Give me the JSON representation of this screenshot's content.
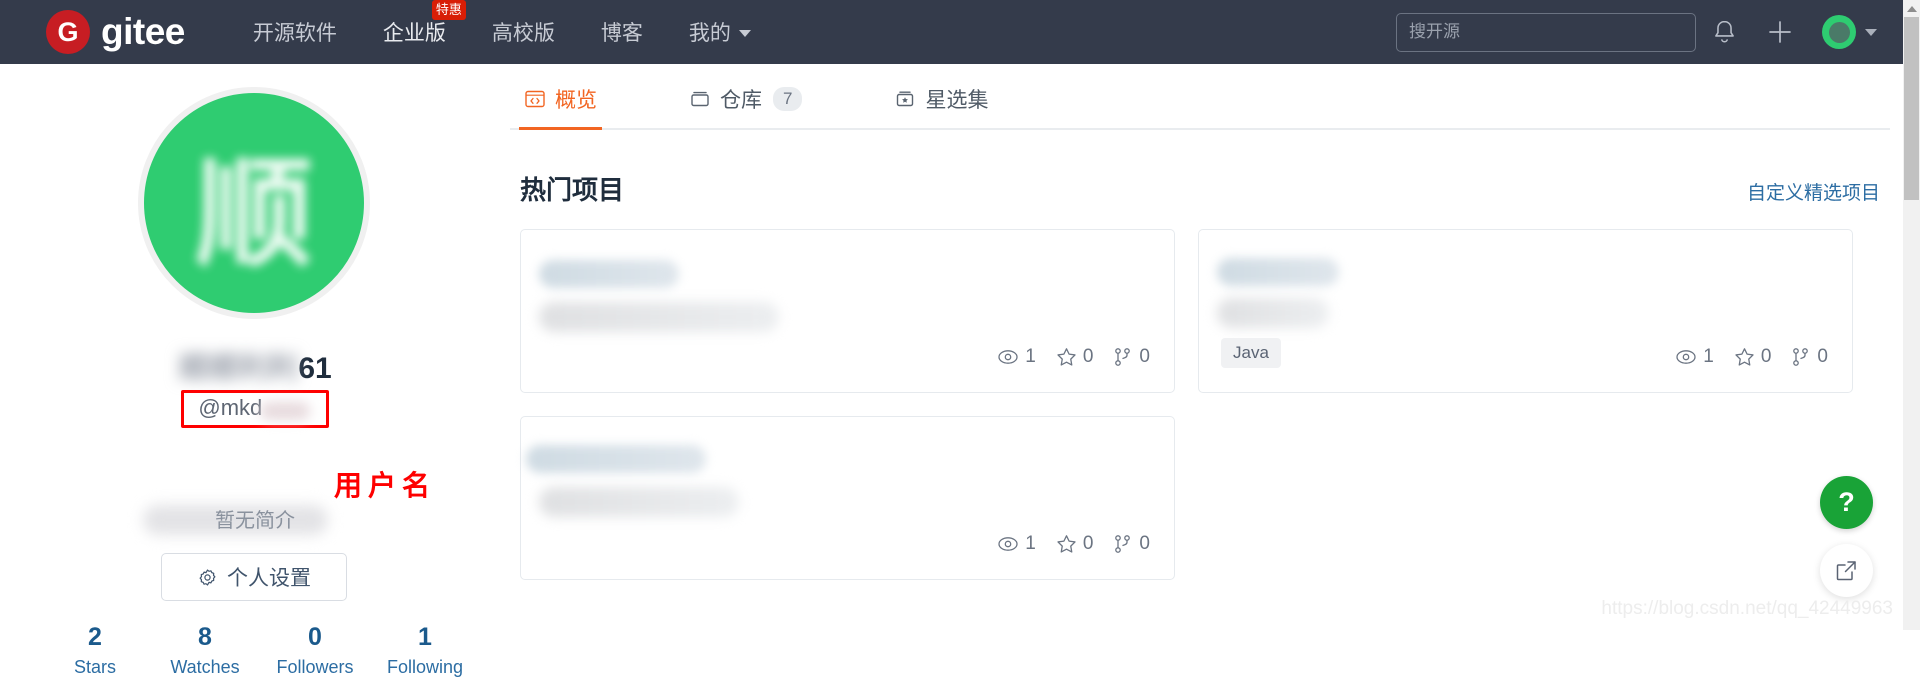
{
  "header": {
    "logo_text": "gitee",
    "logo_mark": "G",
    "nav": [
      {
        "label": "开源软件",
        "badge": null
      },
      {
        "label": "企业版",
        "badge": "特惠"
      },
      {
        "label": "高校版",
        "badge": null
      },
      {
        "label": "博客",
        "badge": null
      },
      {
        "label": "我的",
        "badge": null,
        "has_caret": true
      }
    ],
    "search": {
      "placeholder": "搜开源",
      "value": ""
    },
    "icons": [
      "bell-icon",
      "plus-icon",
      "avatar-icon",
      "chevron-down-icon"
    ]
  },
  "profile": {
    "avatar_glyph": "顺",
    "display_name_blurred": "顺顺利利",
    "display_name_suffix": "61",
    "username_prefix": "@mkd",
    "username_blurred": "xxxxx",
    "annotation": "用户名",
    "bio": "暂无简介",
    "settings_button": "个人设置",
    "stats": [
      {
        "value": "2",
        "label": "Stars"
      },
      {
        "value": "8",
        "label": "Watches"
      },
      {
        "value": "0",
        "label": "Followers"
      },
      {
        "value": "1",
        "label": "Following"
      }
    ]
  },
  "main": {
    "tabs": [
      {
        "label": "概览",
        "icon": "code-overview-icon",
        "badge": null,
        "active": true
      },
      {
        "label": "仓库",
        "icon": "repository-icon",
        "badge": "7",
        "active": false
      },
      {
        "label": "星选集",
        "icon": "star-collection-icon",
        "badge": null,
        "active": false
      }
    ],
    "section_title": "热门项目",
    "section_link": "自定义精选项目",
    "cards": [
      {
        "title_blurred": "",
        "desc_blurred": "",
        "language": null,
        "watches": "1",
        "stars": "0",
        "forks": "0"
      },
      {
        "title_blurred": "",
        "desc_blurred": "",
        "language": "Java",
        "watches": "1",
        "stars": "0",
        "forks": "0"
      },
      {
        "title_blurred": "",
        "desc_blurred": "",
        "language": null,
        "watches": "1",
        "stars": "0",
        "forks": "0"
      }
    ]
  },
  "floating": {
    "help_label": "?",
    "share_icon": "external-link-icon"
  },
  "watermark": "https://blog.csdn.net/qq_42449963",
  "colors": {
    "nav_bg": "#343b4b",
    "brand_red": "#c71d23",
    "accent_orange": "#f26522",
    "link_blue": "#2c6da3",
    "avatar_green": "#2fcc71",
    "annotation_red": "#fe0000",
    "help_green": "#19a337"
  }
}
